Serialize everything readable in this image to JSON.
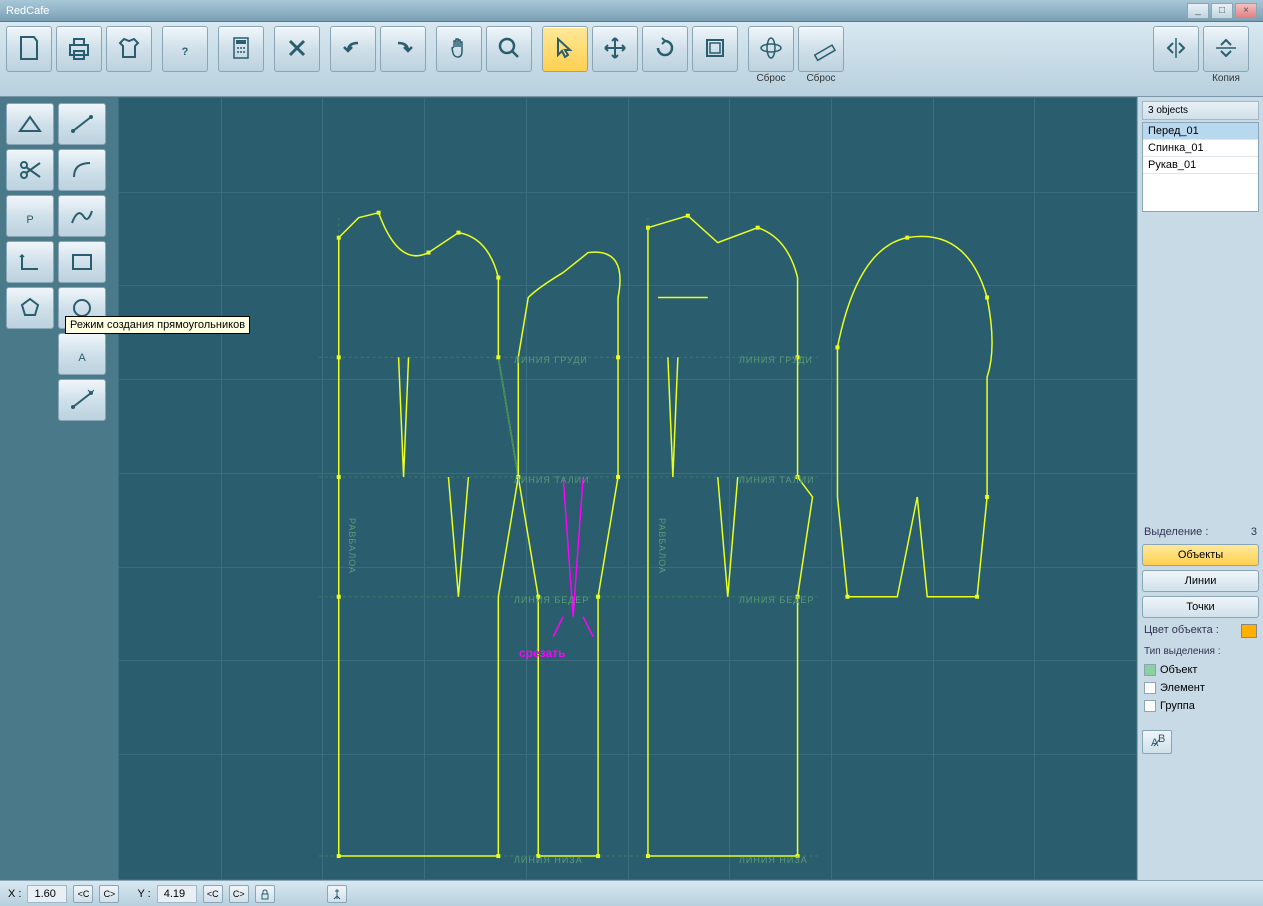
{
  "app_title": "RedCafe",
  "toolbar_labels": {
    "reset1": "Сброс",
    "reset2": "Сброс",
    "copy": "Копия"
  },
  "tooltip": "Режим создания прямоугольников",
  "objects_panel": {
    "header": "3 objects",
    "items": [
      "Перед_01",
      "Спинка_01",
      "Рукав_01"
    ]
  },
  "selection": {
    "label": "Выделение :",
    "count": "3"
  },
  "mode_buttons": {
    "objects": "Объекты",
    "lines": "Линии",
    "points": "Точки"
  },
  "color_label": "Цвет объекта :",
  "color_value": "#ffb000",
  "seltype": {
    "label": "Тип выделения :",
    "opts": [
      "Объект",
      "Элемент",
      "Группа"
    ]
  },
  "status": {
    "x_label": "X :",
    "x_val": "1.60",
    "y_label": "Y :",
    "y_val": "4.19"
  },
  "canvas_labels": {
    "chest": "ЛИНИЯ ГРУДИ",
    "waist": "ЛИНИЯ ТАЛИИ",
    "hip": "ЛИНИЯ БЕДЕР",
    "bottom": "ЛИНИЯ НИЗА",
    "balance": "РАВБАЛОА"
  },
  "annotation": "срезать",
  "nav": {
    "c_left": "<C",
    "c_right": "C>"
  }
}
